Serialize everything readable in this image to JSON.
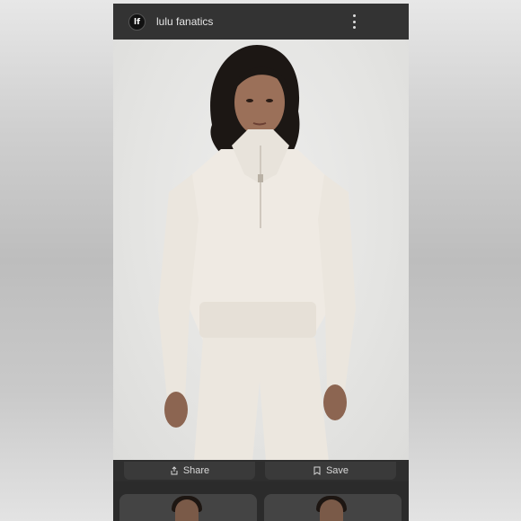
{
  "app": {
    "logo_text": "lf",
    "name": "lulu fanatics"
  },
  "product_image": {
    "description_icon": "model-photo"
  },
  "actions": {
    "share_label": "Share",
    "save_label": "Save"
  },
  "colors": {
    "topbar": "#333333",
    "background": "#2b2b2b",
    "garment": "#efeae3"
  }
}
